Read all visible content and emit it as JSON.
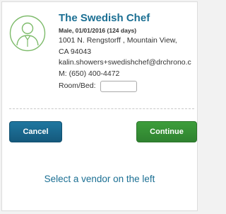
{
  "patient": {
    "name": "The Swedish Chef",
    "demographics": "Male, 01/01/2016 (124 days)",
    "address_line1": "1001 N. Rengstorff , Mountain View,",
    "address_line2": "CA 94043",
    "email": "kalin.showers+swedishchef@drchrono.c",
    "mobile": "M: (650) 400-4472",
    "room_bed_label": "Room/Bed:",
    "room_bed_value": ""
  },
  "buttons": {
    "cancel_label": "Cancel",
    "continue_label": "Continue"
  },
  "prompt": "Select a vendor on the left",
  "colors": {
    "accent": "#1b6f93",
    "cancel": "#1a6891",
    "continue": "#37903a",
    "avatar_outline": "#7dbb6a"
  },
  "icons": {
    "avatar": "person-avatar-icon"
  }
}
